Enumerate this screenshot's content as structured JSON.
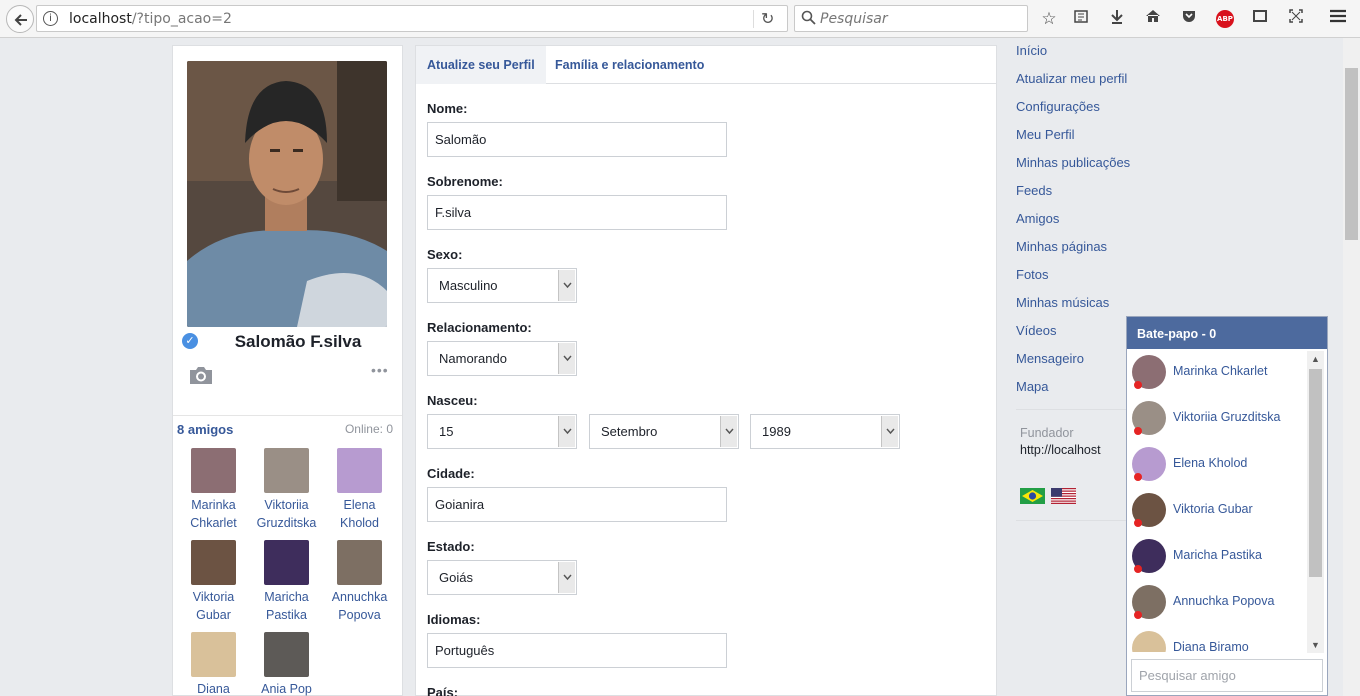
{
  "browser": {
    "url_host": "localhost",
    "url_path": "/?tipo_acao=2",
    "search_placeholder": "Pesquisar",
    "abp_label": "ABP"
  },
  "profile": {
    "name": "Salomão F.silva",
    "friends_label": "8 amigos",
    "online_label": "Online: 0",
    "friends": [
      {
        "name": "Marinka Chkarlet",
        "color": "#8c6e73"
      },
      {
        "name": "Viktoriia Gruzditska",
        "color": "#9a8f86"
      },
      {
        "name": "Elena Kholod",
        "color": "#b79bd0"
      },
      {
        "name": "Viktoria Gubar",
        "color": "#6c5343"
      },
      {
        "name": "Maricha Pastika",
        "color": "#3e2d5c"
      },
      {
        "name": "Annuchka Popova",
        "color": "#7d6f63"
      },
      {
        "name": "Diana",
        "color": "#d9c19a"
      },
      {
        "name": "Ania Pop",
        "color": "#5d5a57"
      }
    ]
  },
  "form": {
    "tabs": [
      "Atualize seu Perfil",
      "Família e relacionamento"
    ],
    "name_label": "Nome:",
    "name_value": "Salomão",
    "surname_label": "Sobrenome:",
    "surname_value": "F.silva",
    "sex_label": "Sexo:",
    "sex_value": "Masculino",
    "relationship_label": "Relacionamento:",
    "relationship_value": "Namorando",
    "born_label": "Nasceu:",
    "born_day": "15",
    "born_month": "Setembro",
    "born_year": "1989",
    "city_label": "Cidade:",
    "city_value": "Goianira",
    "state_label": "Estado:",
    "state_value": "Goiás",
    "languages_label": "Idiomas:",
    "languages_value": "Português",
    "country_label": "País:"
  },
  "nav": {
    "links": [
      "Início",
      "Atualizar meu perfil",
      "Configurações",
      "Meu Perfil",
      "Minhas publicações",
      "Feeds",
      "Amigos",
      "Minhas páginas",
      "Fotos",
      "Minhas músicas",
      "Vídeos",
      "Mensageiro",
      "Mapa"
    ],
    "founder_label": "Fundador",
    "founder_url": "http://localhost"
  },
  "chat": {
    "title": "Bate-papo - 0",
    "contacts": [
      {
        "name": "Marinka Chkarlet",
        "color": "#8c6e73"
      },
      {
        "name": "Viktoriia Gruzditska",
        "color": "#9a8f86"
      },
      {
        "name": "Elena Kholod",
        "color": "#b79bd0"
      },
      {
        "name": "Viktoria Gubar",
        "color": "#6c5343"
      },
      {
        "name": "Maricha Pastika",
        "color": "#3e2d5c"
      },
      {
        "name": "Annuchka Popova",
        "color": "#7d6f63"
      },
      {
        "name": "Diana Biramo",
        "color": "#d9c19a"
      }
    ],
    "search_placeholder": "Pesquisar amigo"
  }
}
